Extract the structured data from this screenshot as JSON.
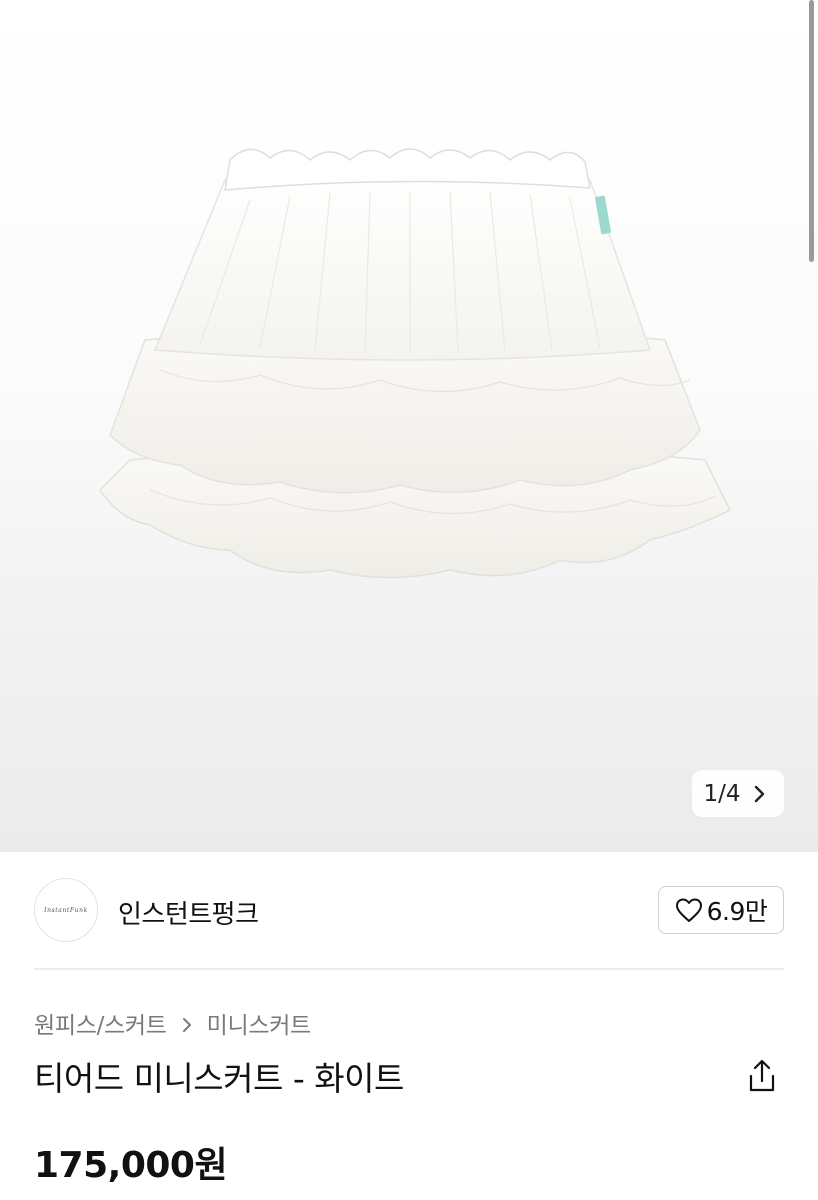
{
  "gallery": {
    "current": "1/4",
    "image_description": "white tiered mini skirt",
    "next_icon": "chevron-right-icon"
  },
  "brand": {
    "logo_text": "InstantFunk",
    "name": "인스턴트펑크",
    "like_icon": "heart-outline-icon",
    "like_count": "6.9만"
  },
  "breadcrumb": {
    "category": "원피스/스커트",
    "separator_icon": "chevron-right-icon",
    "subcategory": "미니스커트"
  },
  "product": {
    "title": "티어드 미니스커트 - 화이트",
    "share_icon": "share-icon",
    "price": "175,000원"
  },
  "colors": {
    "text_primary": "#111111",
    "text_secondary": "#7a7a7a",
    "border": "#cfcfcf",
    "divider": "#ececec"
  }
}
